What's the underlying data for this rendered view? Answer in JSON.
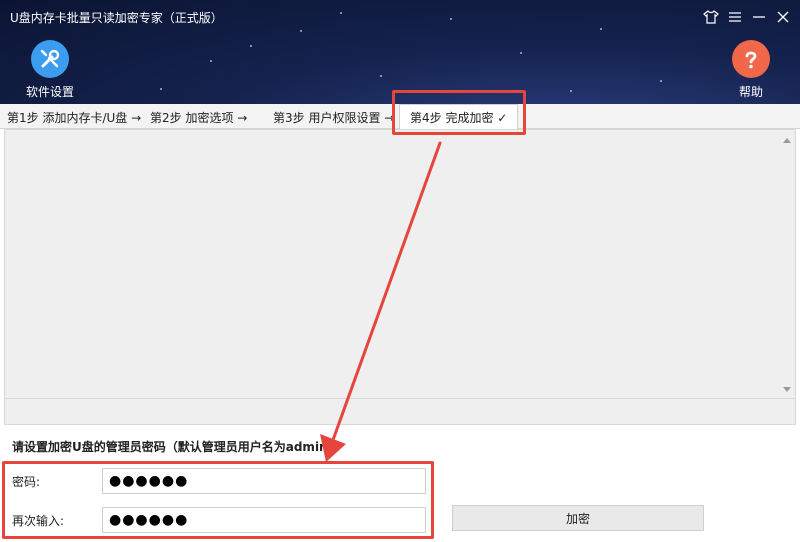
{
  "window": {
    "title": "U盘内存卡批量只读加密专家（正式版）",
    "controls": [
      "skin-icon",
      "menu-icon",
      "minimize-icon",
      "close-icon"
    ]
  },
  "toolbar": {
    "settings_label": "软件设置",
    "help_label": "帮助",
    "settings_color": "#3b9cf0",
    "help_color": "#f0674a"
  },
  "tabs": [
    {
      "label": "第1步 添加内存卡/U盘 →"
    },
    {
      "label": "第2步 加密选项 →"
    },
    {
      "label": "第3步 用户权限设置 →"
    },
    {
      "label": "第4步 完成加密 ✓",
      "active": true
    }
  ],
  "form": {
    "title": "请设置加密U盘的管理员密码（默认管理员用户名为admin）",
    "password_label": "密码:",
    "password_value": "●●●●●●",
    "confirm_label": "再次输入:",
    "confirm_value": "●●●●●●",
    "encrypt_label": "加密"
  },
  "annotation": {
    "color": "#e5453a"
  }
}
